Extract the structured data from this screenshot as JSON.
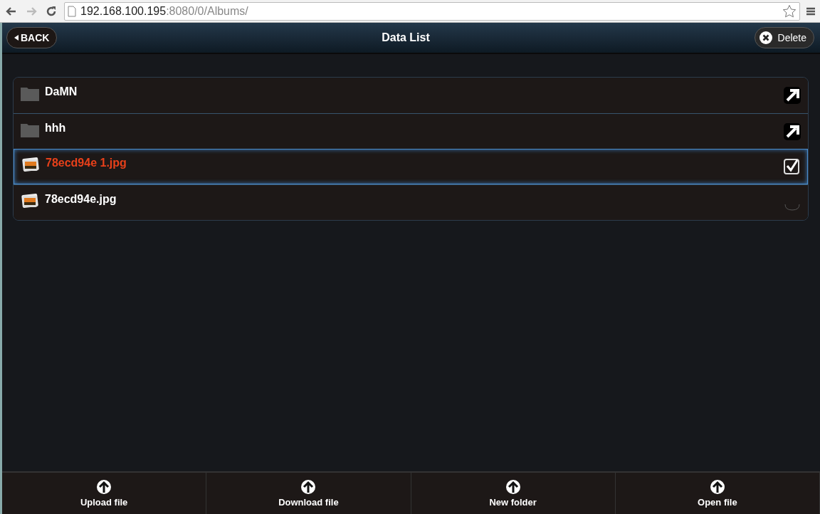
{
  "browser": {
    "url_host": "192.168.100.195",
    "url_path": ":8080/0/Albums/"
  },
  "header": {
    "back": "BACK",
    "title": "Data List",
    "delete": "Delete"
  },
  "items": [
    {
      "kind": "folder",
      "name": "DaMN",
      "selected": false
    },
    {
      "kind": "folder",
      "name": "hhh",
      "selected": false
    },
    {
      "kind": "image",
      "name": "78ecd94e 1.jpg",
      "selected": true,
      "checked": true
    },
    {
      "kind": "image",
      "name": "78ecd94e.jpg",
      "selected": false,
      "checked": false
    }
  ],
  "toolbar": [
    {
      "label": "Upload file"
    },
    {
      "label": "Download file"
    },
    {
      "label": "New folder"
    },
    {
      "label": "Open file"
    }
  ]
}
